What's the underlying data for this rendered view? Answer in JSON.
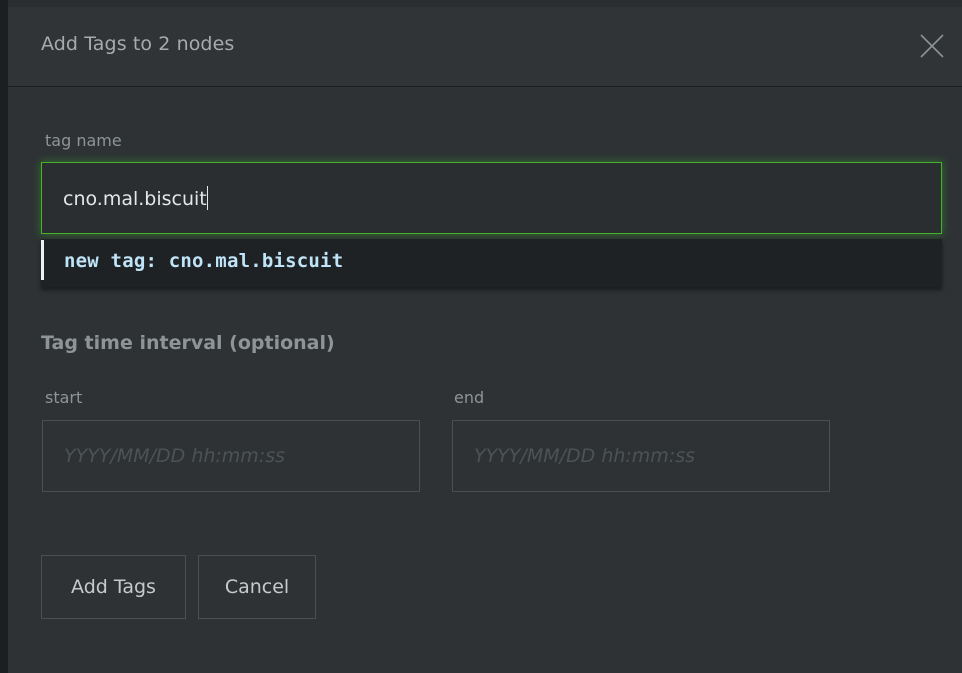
{
  "dialog": {
    "title": "Add Tags to 2 nodes",
    "close_icon": "close-icon"
  },
  "tag_field": {
    "label": "tag name",
    "value": "cno.mal.biscuit"
  },
  "suggestion": {
    "text": "new tag: cno.mal.biscuit"
  },
  "interval": {
    "title": "Tag time interval (optional)",
    "start_label": "start",
    "start_placeholder": "YYYY/MM/DD hh:mm:ss",
    "end_label": "end",
    "end_placeholder": "YYYY/MM/DD hh:mm:ss"
  },
  "actions": {
    "add_label": "Add Tags",
    "cancel_label": "Cancel"
  },
  "colors": {
    "background": "#2e3235",
    "focus_border": "#44b32a",
    "suggestion_text": "#bfe3f7"
  }
}
